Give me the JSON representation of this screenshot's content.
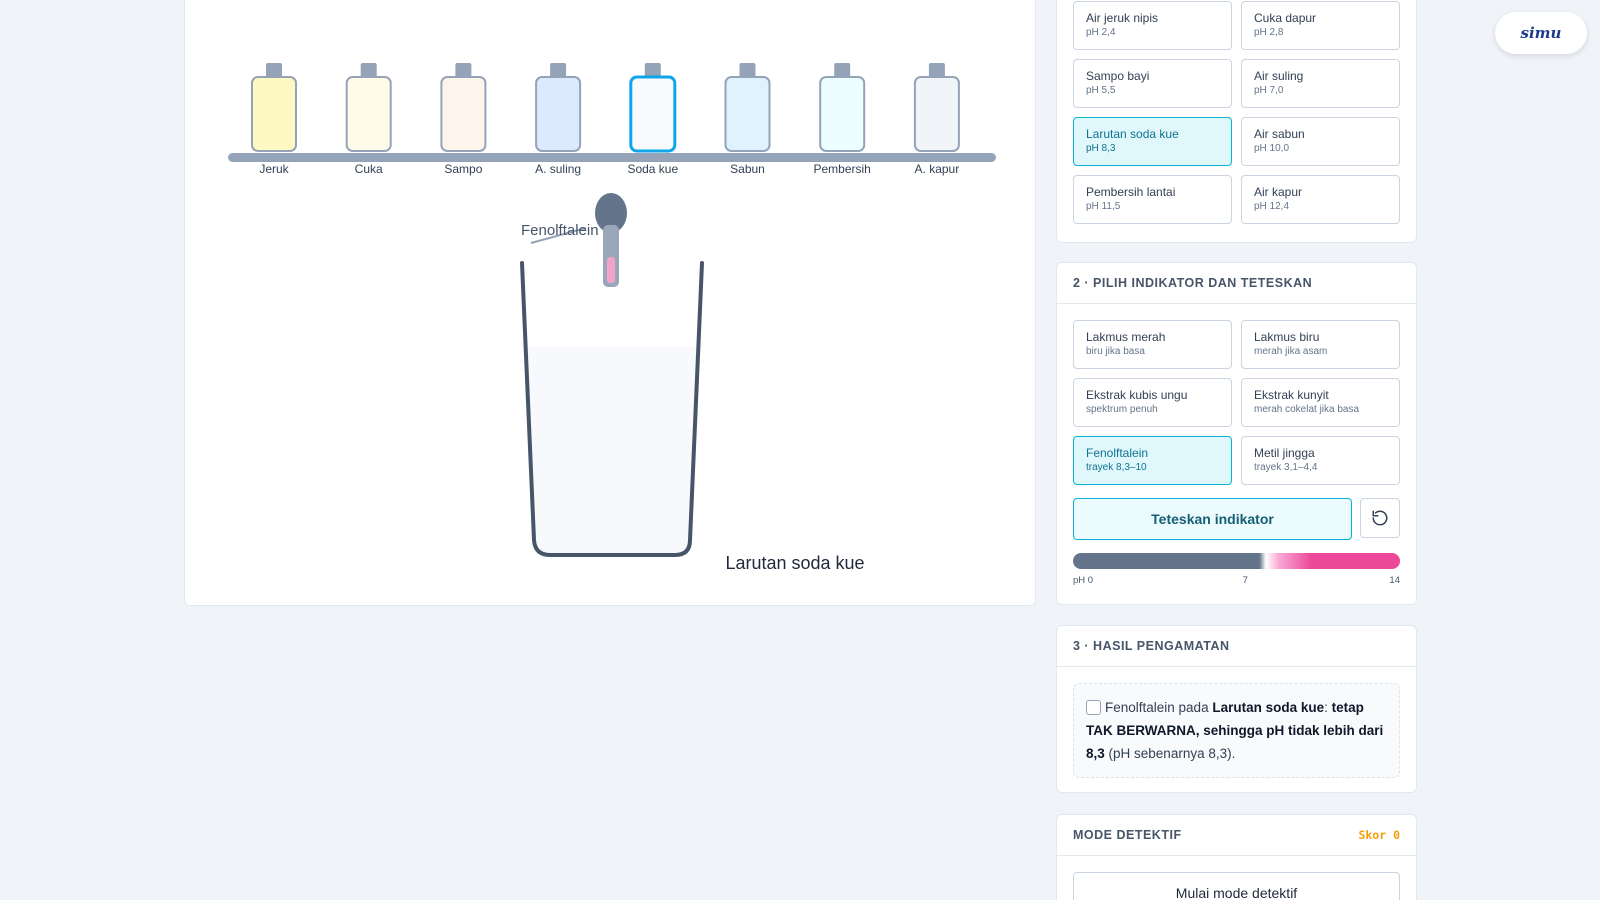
{
  "lab": {
    "bottles": [
      {
        "label": "Jeruk",
        "color": "#fef9c3",
        "selected": false
      },
      {
        "label": "Cuka",
        "color": "#fefce8",
        "selected": false
      },
      {
        "label": "Sampo",
        "color": "#fdf4ec",
        "selected": false
      },
      {
        "label": "A. suling",
        "color": "#dbeafe",
        "selected": false
      },
      {
        "label": "Soda kue",
        "color": "#f8fafc",
        "selected": true
      },
      {
        "label": "Sabun",
        "color": "#e0f2fe",
        "selected": false
      },
      {
        "label": "Pembersih",
        "color": "#ecfeff",
        "selected": false
      },
      {
        "label": "A. kapur",
        "color": "#f1f5f9",
        "selected": false
      }
    ],
    "indicator_tag": "Fenolftalein",
    "beaker_label": "Larutan soda kue",
    "liquid_color": "#f7f9fc",
    "accent": "#0ea5e9"
  },
  "solutions": {
    "items": [
      {
        "name": "Air jeruk nipis",
        "sub": "pH 2,4",
        "selected": false
      },
      {
        "name": "Cuka dapur",
        "sub": "pH 2,8",
        "selected": false
      },
      {
        "name": "Sampo bayi",
        "sub": "pH 5,5",
        "selected": false
      },
      {
        "name": "Air suling",
        "sub": "pH 7,0",
        "selected": false
      },
      {
        "name": "Larutan soda kue",
        "sub": "pH 8,3",
        "selected": true
      },
      {
        "name": "Air sabun",
        "sub": "pH 10,0",
        "selected": false
      },
      {
        "name": "Pembersih lantai",
        "sub": "pH 11,5",
        "selected": false
      },
      {
        "name": "Air kapur",
        "sub": "pH 12,4",
        "selected": false
      }
    ]
  },
  "indicators": {
    "title": "2 · PILIH INDIKATOR DAN TETESKAN",
    "items": [
      {
        "name": "Lakmus merah",
        "sub": "biru jika basa",
        "selected": false
      },
      {
        "name": "Lakmus biru",
        "sub": "merah jika asam",
        "selected": false
      },
      {
        "name": "Ekstrak kubis ungu",
        "sub": "spektrum penuh",
        "selected": false
      },
      {
        "name": "Ekstrak kunyit",
        "sub": "merah cokelat jika basa",
        "selected": false
      },
      {
        "name": "Fenolftalein",
        "sub": "trayek 8,3–10",
        "selected": true
      },
      {
        "name": "Metil jingga",
        "sub": "trayek 3,1–4,4",
        "selected": false
      }
    ],
    "drop_label": "Teteskan indikator",
    "reset_icon": "reset-icon",
    "scale": {
      "min": "pH 0",
      "mid": "7",
      "max": "14"
    }
  },
  "result": {
    "title": "3 · HASIL PENGAMATAN",
    "prefix": "Fenolftalein pada ",
    "solution": "Larutan soda kue",
    "colon": ": ",
    "verdict": "tetap TAK BERWARNA, sehingga pH tidak lebih dari 8,3",
    "suffix": " (pH sebenarnya 8,3)."
  },
  "detective": {
    "title": "MODE DETEKTIF",
    "score": "Skor 0",
    "start_label": "Mulai mode detektif"
  },
  "logo": {
    "text": "simu"
  }
}
